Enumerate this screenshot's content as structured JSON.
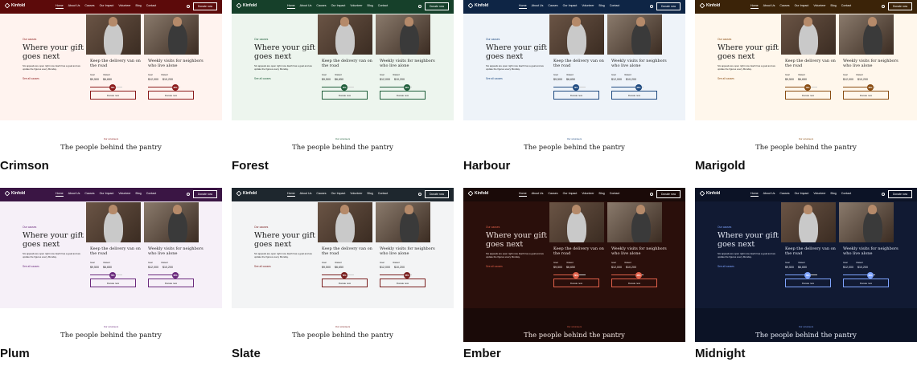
{
  "site": {
    "logo": "Kinfold",
    "nav": [
      "Home",
      "About Us",
      "Causes",
      "Our Impact",
      "Volunteer",
      "Blog",
      "Contact"
    ],
    "nav_button": "Donate now"
  },
  "hero": {
    "eyebrow": "Our causes",
    "title": "Where your gift goes next",
    "text": "Six appeals are open right now. Each has a goal and we update the figures every Monday.",
    "link": "See all causes"
  },
  "cards": [
    {
      "title": "Keep the delivery van on the road",
      "goal_label": "Goal",
      "raised_label": "Raised",
      "goal": "$9,500",
      "raised": "$6,650",
      "percent": 70,
      "percent_label": "70%",
      "button": "Donate now"
    },
    {
      "title": "Weekly visits for neighbors who live alone",
      "goal_label": "Goal",
      "raised_label": "Raised",
      "goal": "$12,000",
      "raised": "$10,200",
      "percent": 85,
      "percent_label": "85%",
      "button": "Donate now"
    }
  ],
  "lower": {
    "eyebrow": "Our volunteers",
    "title": "The people behind the pantry"
  },
  "themes": [
    {
      "label": "Crimson",
      "nav": "#5c0a0a",
      "bg": "#fff3ef",
      "accent": "#8b1a1a",
      "text": "#1a1a1a",
      "lower": "#ffffff",
      "lower_text": "#1a1a1a"
    },
    {
      "label": "Forest",
      "nav": "#16402a",
      "bg": "#edf5ee",
      "accent": "#1f5e3a",
      "text": "#1a1a1a",
      "lower": "#ffffff",
      "lower_text": "#1a1a1a"
    },
    {
      "label": "Harbour",
      "nav": "#0e2545",
      "bg": "#eef3f9",
      "accent": "#1e4a80",
      "text": "#1a1a1a",
      "lower": "#ffffff",
      "lower_text": "#1a1a1a"
    },
    {
      "label": "Marigold",
      "nav": "#3b2308",
      "bg": "#fff7ec",
      "accent": "#8a4d12",
      "text": "#1a1a1a",
      "lower": "#ffffff",
      "lower_text": "#1a1a1a"
    },
    {
      "label": "Plum",
      "nav": "#3a1544",
      "bg": "#f6f0f8",
      "accent": "#6b2a7d",
      "text": "#1a1a1a",
      "lower": "#ffffff",
      "lower_text": "#1a1a1a"
    },
    {
      "label": "Slate",
      "nav": "#1e272e",
      "bg": "#f3f4f5",
      "accent": "#7a1f1f",
      "text": "#1a1a1a",
      "lower": "#ffffff",
      "lower_text": "#1a1a1a"
    },
    {
      "label": "Ember",
      "nav": "#1a0a08",
      "bg": "#2a0f0b",
      "accent": "#e0604a",
      "text": "#f3e6e2",
      "lower": "#1a0a08",
      "lower_text": "#f3e6e2"
    },
    {
      "label": "Midnight",
      "nav": "#0c1326",
      "bg": "#111a33",
      "accent": "#7fa4ff",
      "text": "#e6ebf7",
      "lower": "#0c1326",
      "lower_text": "#e6ebf7"
    }
  ]
}
